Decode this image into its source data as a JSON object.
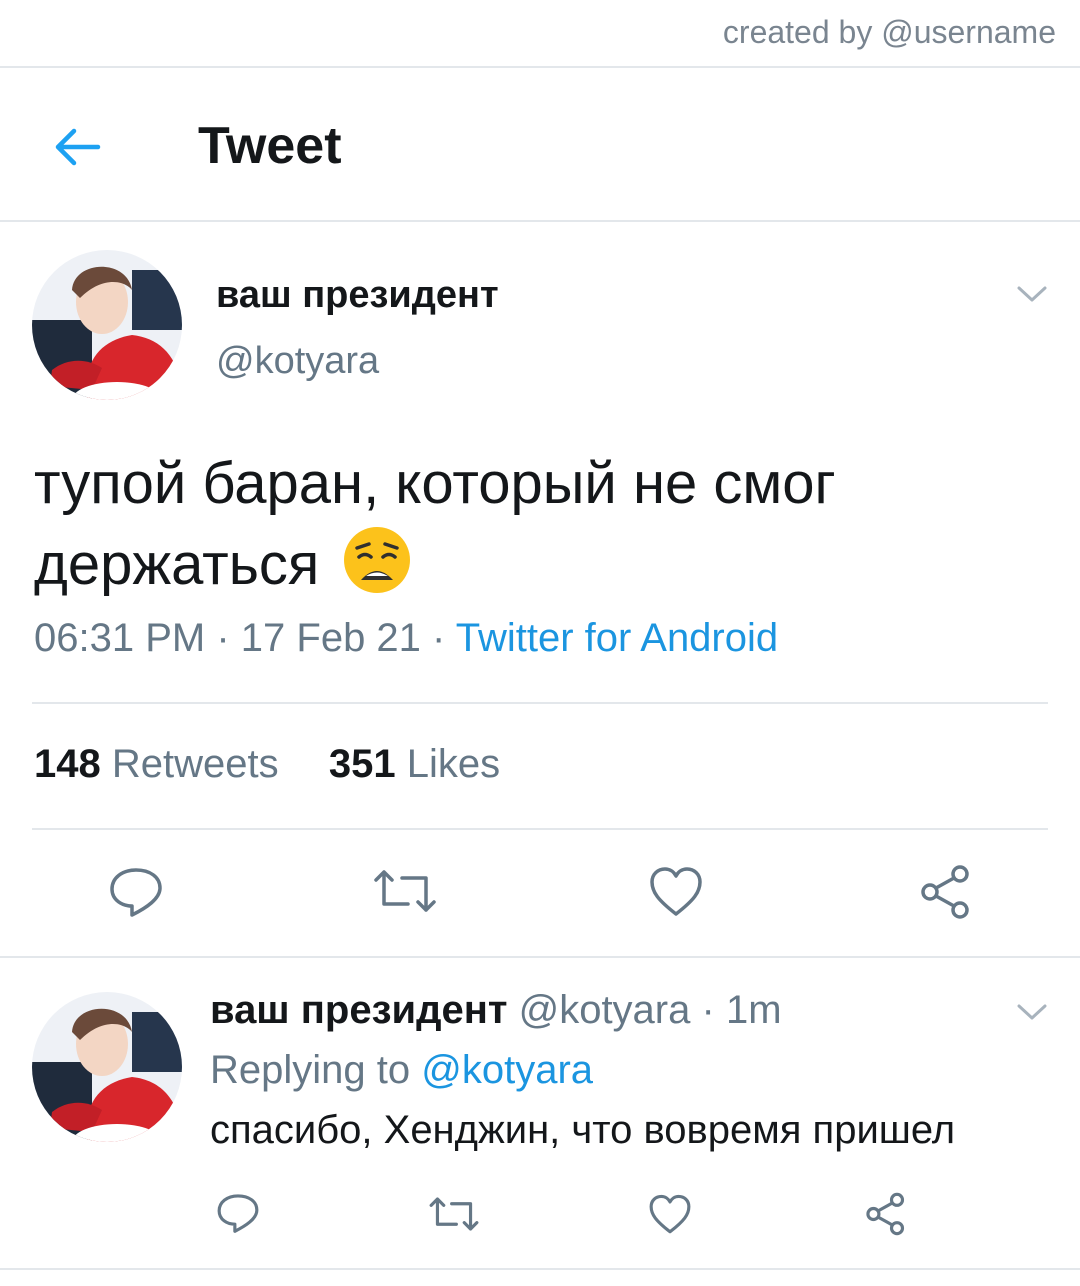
{
  "watermark": "created by @username",
  "header": {
    "title": "Tweet",
    "back_icon": "arrow-left-icon"
  },
  "tweet": {
    "display_name": "ваш президент",
    "handle": "@kotyara",
    "text": "тупой баран, который не смог держаться",
    "emoji": "weary-face",
    "time": "06:31 PM",
    "date": "17 Feb 21",
    "source": "Twitter for Android",
    "retweets_count": "148",
    "retweets_label": "Retweets",
    "likes_count": "351",
    "likes_label": "Likes",
    "actions": [
      "reply-icon",
      "retweet-icon",
      "like-icon",
      "share-icon"
    ]
  },
  "reply": {
    "display_name": "ваш президент",
    "handle": "@kotyara",
    "time_ago": "1m",
    "replying_prefix": "Replying to",
    "replying_to": "@kotyara",
    "text": "спасибо, Хенджин, что вовремя пришел",
    "actions": [
      "reply-icon",
      "retweet-icon",
      "like-icon",
      "share-icon"
    ]
  },
  "colors": {
    "accent": "#1b95e0",
    "muted": "#657786",
    "text": "#14171a",
    "divider": "#e3e7eb"
  }
}
